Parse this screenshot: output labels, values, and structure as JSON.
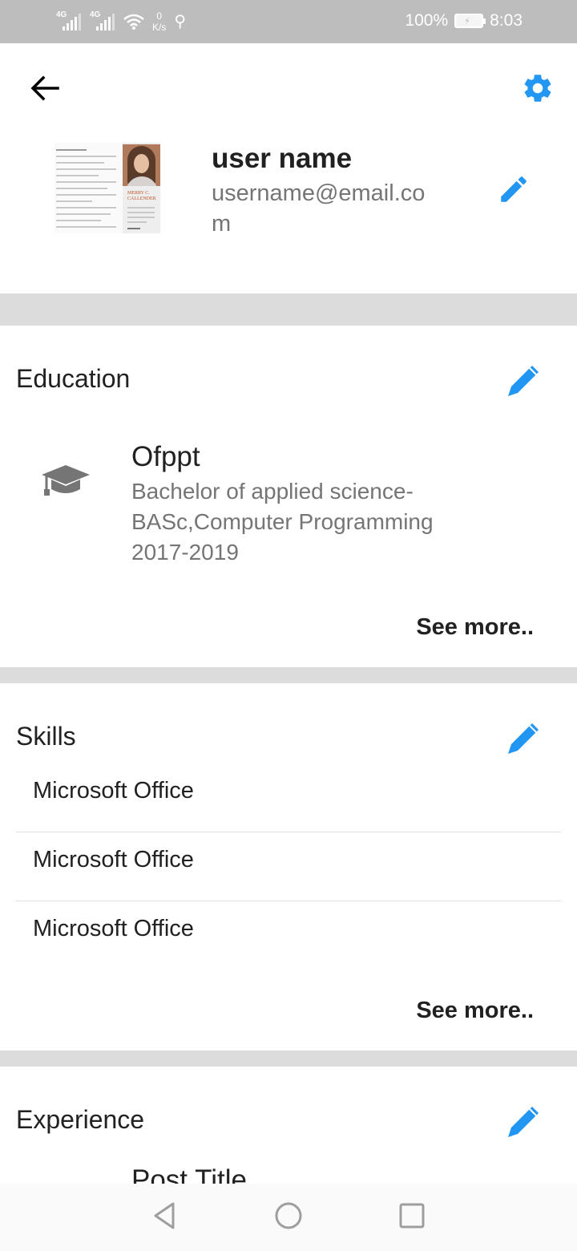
{
  "status_bar": {
    "signal_1": "4G",
    "signal_2": "4G",
    "speed_value": "0",
    "speed_unit": "K/s",
    "battery": "100%",
    "time": "8:03"
  },
  "profile": {
    "name": "user name",
    "email": "username@email.com"
  },
  "education": {
    "title": "Education",
    "school": "Ofppt",
    "degree_line1": "Bachelor of applied science-",
    "degree_line2": "BASc,Computer Programming",
    "years": "2017-2019",
    "see_more": "See more.."
  },
  "skills": {
    "title": "Skills",
    "items": [
      "Microsoft Office",
      "Microsoft Office",
      "Microsoft Office"
    ],
    "see_more": "See more.."
  },
  "experience": {
    "title": "Experience",
    "post_title": "Post Title"
  },
  "colors": {
    "accent": "#2196F3",
    "status_bar": "#BDBDBD",
    "divider": "#DCDCDC",
    "secondary_text": "#757575"
  },
  "icons": [
    "back-arrow-icon",
    "gear-icon",
    "pencil-icon",
    "pen-icon",
    "graduation-cap-icon",
    "nav-back-icon",
    "nav-home-icon",
    "nav-recents-icon"
  ]
}
